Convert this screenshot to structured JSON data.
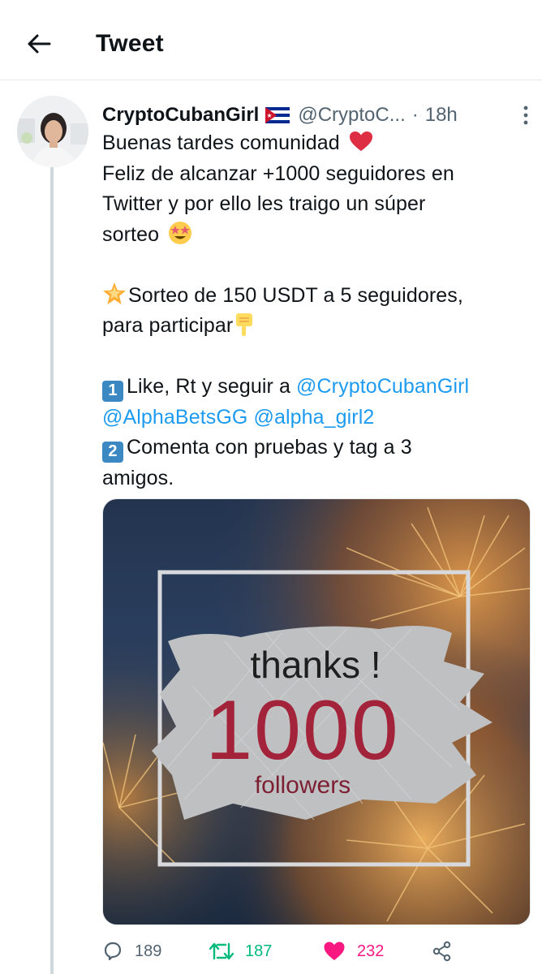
{
  "header": {
    "title": "Tweet",
    "back_icon": "arrow-left-icon"
  },
  "tweet": {
    "author_name": "CryptoCubanGirl",
    "flag": "cuba-flag",
    "handle": "@CryptoC...",
    "separator": "·",
    "time": "18h",
    "lines": {
      "l1": "Buenas tardes comunidad",
      "l2": "Feliz de alcanzar +1000 seguidores en",
      "l3": "Twitter y por ello les traigo un súper",
      "l4": "sorteo",
      "l5": "Sorteo de 150 USDT a 5 seguidores,",
      "l6": "para participar",
      "l7a": "Like, Rt y seguir a ",
      "l7b": "@CryptoCubanGirl",
      "l8a": "@AlphaBetsGG",
      "l8b": "@alpha_girl2",
      "l9": "Comenta con pruebas y tag a 3",
      "l10": "amigos."
    },
    "keycaps": {
      "one": "1",
      "two": "2"
    },
    "image": {
      "line1": "thanks !",
      "line2": "1000",
      "line3": "followers"
    },
    "stats": {
      "replies": "189",
      "retweets": "187",
      "likes": "232"
    },
    "colors": {
      "link": "#1d9bf0",
      "retweet": "#00ba7c",
      "like": "#f91880",
      "number_red": "#a3243a"
    }
  }
}
